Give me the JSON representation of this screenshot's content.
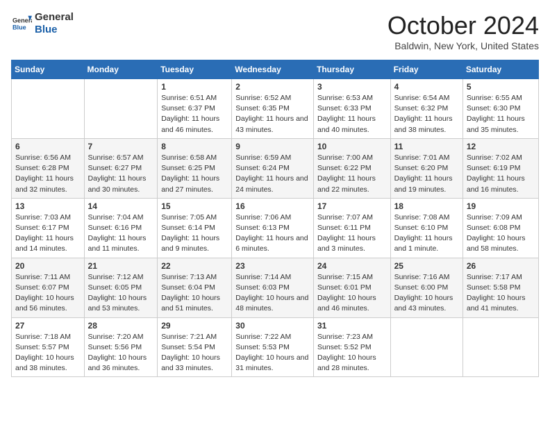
{
  "header": {
    "logo_line1": "General",
    "logo_line2": "Blue",
    "month_title": "October 2024",
    "location": "Baldwin, New York, United States"
  },
  "days_of_week": [
    "Sunday",
    "Monday",
    "Tuesday",
    "Wednesday",
    "Thursday",
    "Friday",
    "Saturday"
  ],
  "weeks": [
    [
      {
        "day": null,
        "content": ""
      },
      {
        "day": null,
        "content": ""
      },
      {
        "day": 1,
        "content": "Sunrise: 6:51 AM\nSunset: 6:37 PM\nDaylight: 11 hours and 46 minutes."
      },
      {
        "day": 2,
        "content": "Sunrise: 6:52 AM\nSunset: 6:35 PM\nDaylight: 11 hours and 43 minutes."
      },
      {
        "day": 3,
        "content": "Sunrise: 6:53 AM\nSunset: 6:33 PM\nDaylight: 11 hours and 40 minutes."
      },
      {
        "day": 4,
        "content": "Sunrise: 6:54 AM\nSunset: 6:32 PM\nDaylight: 11 hours and 38 minutes."
      },
      {
        "day": 5,
        "content": "Sunrise: 6:55 AM\nSunset: 6:30 PM\nDaylight: 11 hours and 35 minutes."
      }
    ],
    [
      {
        "day": 6,
        "content": "Sunrise: 6:56 AM\nSunset: 6:28 PM\nDaylight: 11 hours and 32 minutes."
      },
      {
        "day": 7,
        "content": "Sunrise: 6:57 AM\nSunset: 6:27 PM\nDaylight: 11 hours and 30 minutes."
      },
      {
        "day": 8,
        "content": "Sunrise: 6:58 AM\nSunset: 6:25 PM\nDaylight: 11 hours and 27 minutes."
      },
      {
        "day": 9,
        "content": "Sunrise: 6:59 AM\nSunset: 6:24 PM\nDaylight: 11 hours and 24 minutes."
      },
      {
        "day": 10,
        "content": "Sunrise: 7:00 AM\nSunset: 6:22 PM\nDaylight: 11 hours and 22 minutes."
      },
      {
        "day": 11,
        "content": "Sunrise: 7:01 AM\nSunset: 6:20 PM\nDaylight: 11 hours and 19 minutes."
      },
      {
        "day": 12,
        "content": "Sunrise: 7:02 AM\nSunset: 6:19 PM\nDaylight: 11 hours and 16 minutes."
      }
    ],
    [
      {
        "day": 13,
        "content": "Sunrise: 7:03 AM\nSunset: 6:17 PM\nDaylight: 11 hours and 14 minutes."
      },
      {
        "day": 14,
        "content": "Sunrise: 7:04 AM\nSunset: 6:16 PM\nDaylight: 11 hours and 11 minutes."
      },
      {
        "day": 15,
        "content": "Sunrise: 7:05 AM\nSunset: 6:14 PM\nDaylight: 11 hours and 9 minutes."
      },
      {
        "day": 16,
        "content": "Sunrise: 7:06 AM\nSunset: 6:13 PM\nDaylight: 11 hours and 6 minutes."
      },
      {
        "day": 17,
        "content": "Sunrise: 7:07 AM\nSunset: 6:11 PM\nDaylight: 11 hours and 3 minutes."
      },
      {
        "day": 18,
        "content": "Sunrise: 7:08 AM\nSunset: 6:10 PM\nDaylight: 11 hours and 1 minute."
      },
      {
        "day": 19,
        "content": "Sunrise: 7:09 AM\nSunset: 6:08 PM\nDaylight: 10 hours and 58 minutes."
      }
    ],
    [
      {
        "day": 20,
        "content": "Sunrise: 7:11 AM\nSunset: 6:07 PM\nDaylight: 10 hours and 56 minutes."
      },
      {
        "day": 21,
        "content": "Sunrise: 7:12 AM\nSunset: 6:05 PM\nDaylight: 10 hours and 53 minutes."
      },
      {
        "day": 22,
        "content": "Sunrise: 7:13 AM\nSunset: 6:04 PM\nDaylight: 10 hours and 51 minutes."
      },
      {
        "day": 23,
        "content": "Sunrise: 7:14 AM\nSunset: 6:03 PM\nDaylight: 10 hours and 48 minutes."
      },
      {
        "day": 24,
        "content": "Sunrise: 7:15 AM\nSunset: 6:01 PM\nDaylight: 10 hours and 46 minutes."
      },
      {
        "day": 25,
        "content": "Sunrise: 7:16 AM\nSunset: 6:00 PM\nDaylight: 10 hours and 43 minutes."
      },
      {
        "day": 26,
        "content": "Sunrise: 7:17 AM\nSunset: 5:58 PM\nDaylight: 10 hours and 41 minutes."
      }
    ],
    [
      {
        "day": 27,
        "content": "Sunrise: 7:18 AM\nSunset: 5:57 PM\nDaylight: 10 hours and 38 minutes."
      },
      {
        "day": 28,
        "content": "Sunrise: 7:20 AM\nSunset: 5:56 PM\nDaylight: 10 hours and 36 minutes."
      },
      {
        "day": 29,
        "content": "Sunrise: 7:21 AM\nSunset: 5:54 PM\nDaylight: 10 hours and 33 minutes."
      },
      {
        "day": 30,
        "content": "Sunrise: 7:22 AM\nSunset: 5:53 PM\nDaylight: 10 hours and 31 minutes."
      },
      {
        "day": 31,
        "content": "Sunrise: 7:23 AM\nSunset: 5:52 PM\nDaylight: 10 hours and 28 minutes."
      },
      {
        "day": null,
        "content": ""
      },
      {
        "day": null,
        "content": ""
      }
    ]
  ]
}
